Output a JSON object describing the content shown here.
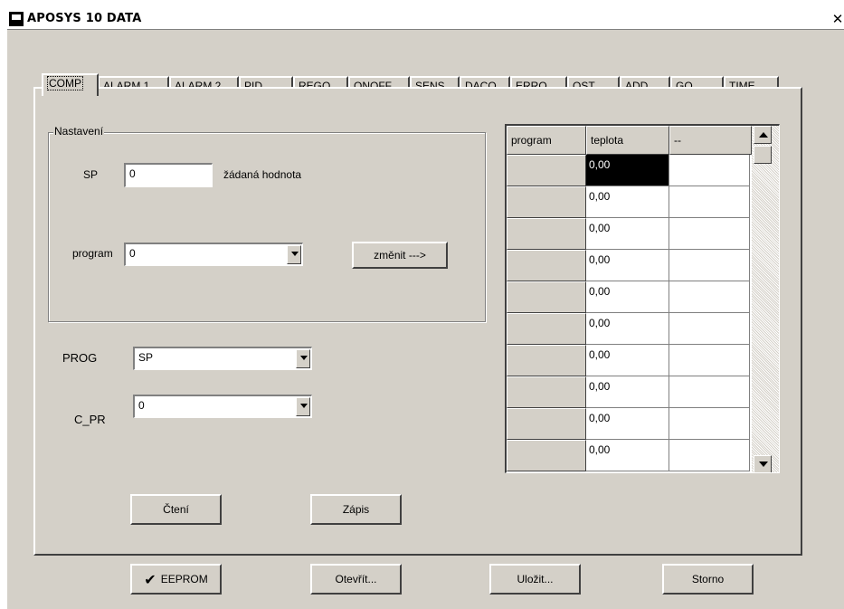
{
  "window": {
    "title": "APOSYS 10 DATA",
    "close_glyph": "✕"
  },
  "tabs": [
    "COMP",
    "ALARM 1",
    "ALARM 2",
    "PID",
    "REGO",
    "ONOFF",
    "SENS",
    "DACO",
    "ERRO",
    "OST_",
    "ADD",
    "GO",
    "TIME"
  ],
  "nastaveni": {
    "label": "Nastavení",
    "sp_label": "SP",
    "sp_value": "0",
    "sp_hint": "žádaná hodnota",
    "program_label": "program",
    "program_value": "0",
    "change_button": "změnit --->"
  },
  "prog": {
    "label": "PROG",
    "value": "SP"
  },
  "c_pr": {
    "label": "C_PR",
    "value": "0"
  },
  "read_button": "Čtení",
  "write_button": "Zápis",
  "table": {
    "columns": [
      "program",
      "teplota",
      "--"
    ],
    "rows": [
      "0,00",
      "0,00",
      "0,00",
      "0,00",
      "0,00",
      "0,00",
      "0,00",
      "0,00",
      "0,00",
      "0,00"
    ]
  },
  "footer": {
    "eeprom": "EEPROM",
    "open": "Otevřít...",
    "save": "Uložit...",
    "cancel": "Storno"
  }
}
